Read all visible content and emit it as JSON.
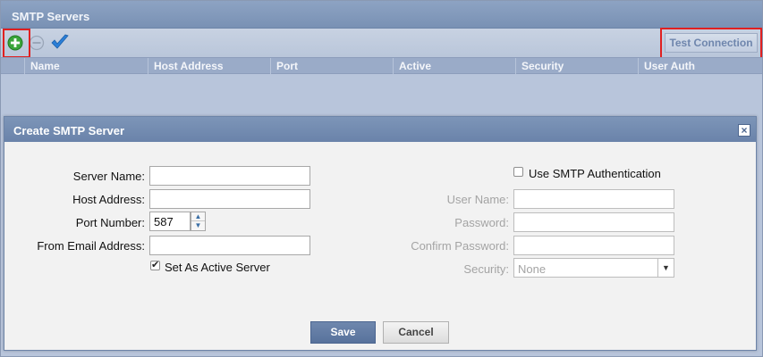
{
  "panel": {
    "title": "SMTP Servers",
    "toolbar": {
      "add_icon": "add-circle-icon",
      "remove_icon": "remove-circle-icon",
      "confirm_icon": "checkmark-icon",
      "test_connection_label": "Test Connection",
      "highlight_color": "#e02020"
    },
    "columns": [
      "Name",
      "Host Address",
      "Port",
      "Active",
      "Security",
      "User Auth"
    ]
  },
  "dialog": {
    "title": "Create SMTP Server",
    "close_icon": "close-icon",
    "left": {
      "server_name_label": "Server Name:",
      "server_name_value": "",
      "host_address_label": "Host Address:",
      "host_address_value": "",
      "port_number_label": "Port Number:",
      "port_number_value": "587",
      "from_email_label": "From Email Address:",
      "from_email_value": "",
      "set_active_label": "Set As Active Server",
      "set_active_checked": true
    },
    "right": {
      "use_auth_label": "Use SMTP Authentication",
      "use_auth_checked": false,
      "user_name_label": "User Name:",
      "user_name_value": "",
      "password_label": "Password:",
      "password_value": "",
      "confirm_password_label": "Confirm Password:",
      "confirm_password_value": "",
      "security_label": "Security:",
      "security_value": "None"
    },
    "buttons": {
      "save_label": "Save",
      "cancel_label": "Cancel"
    }
  },
  "colors": {
    "header": "#7991b4",
    "dialog_header": "#6a83aa",
    "save_button": "#58729c",
    "add_icon": "#3aa53a",
    "confirm_icon": "#2b7fd8"
  }
}
